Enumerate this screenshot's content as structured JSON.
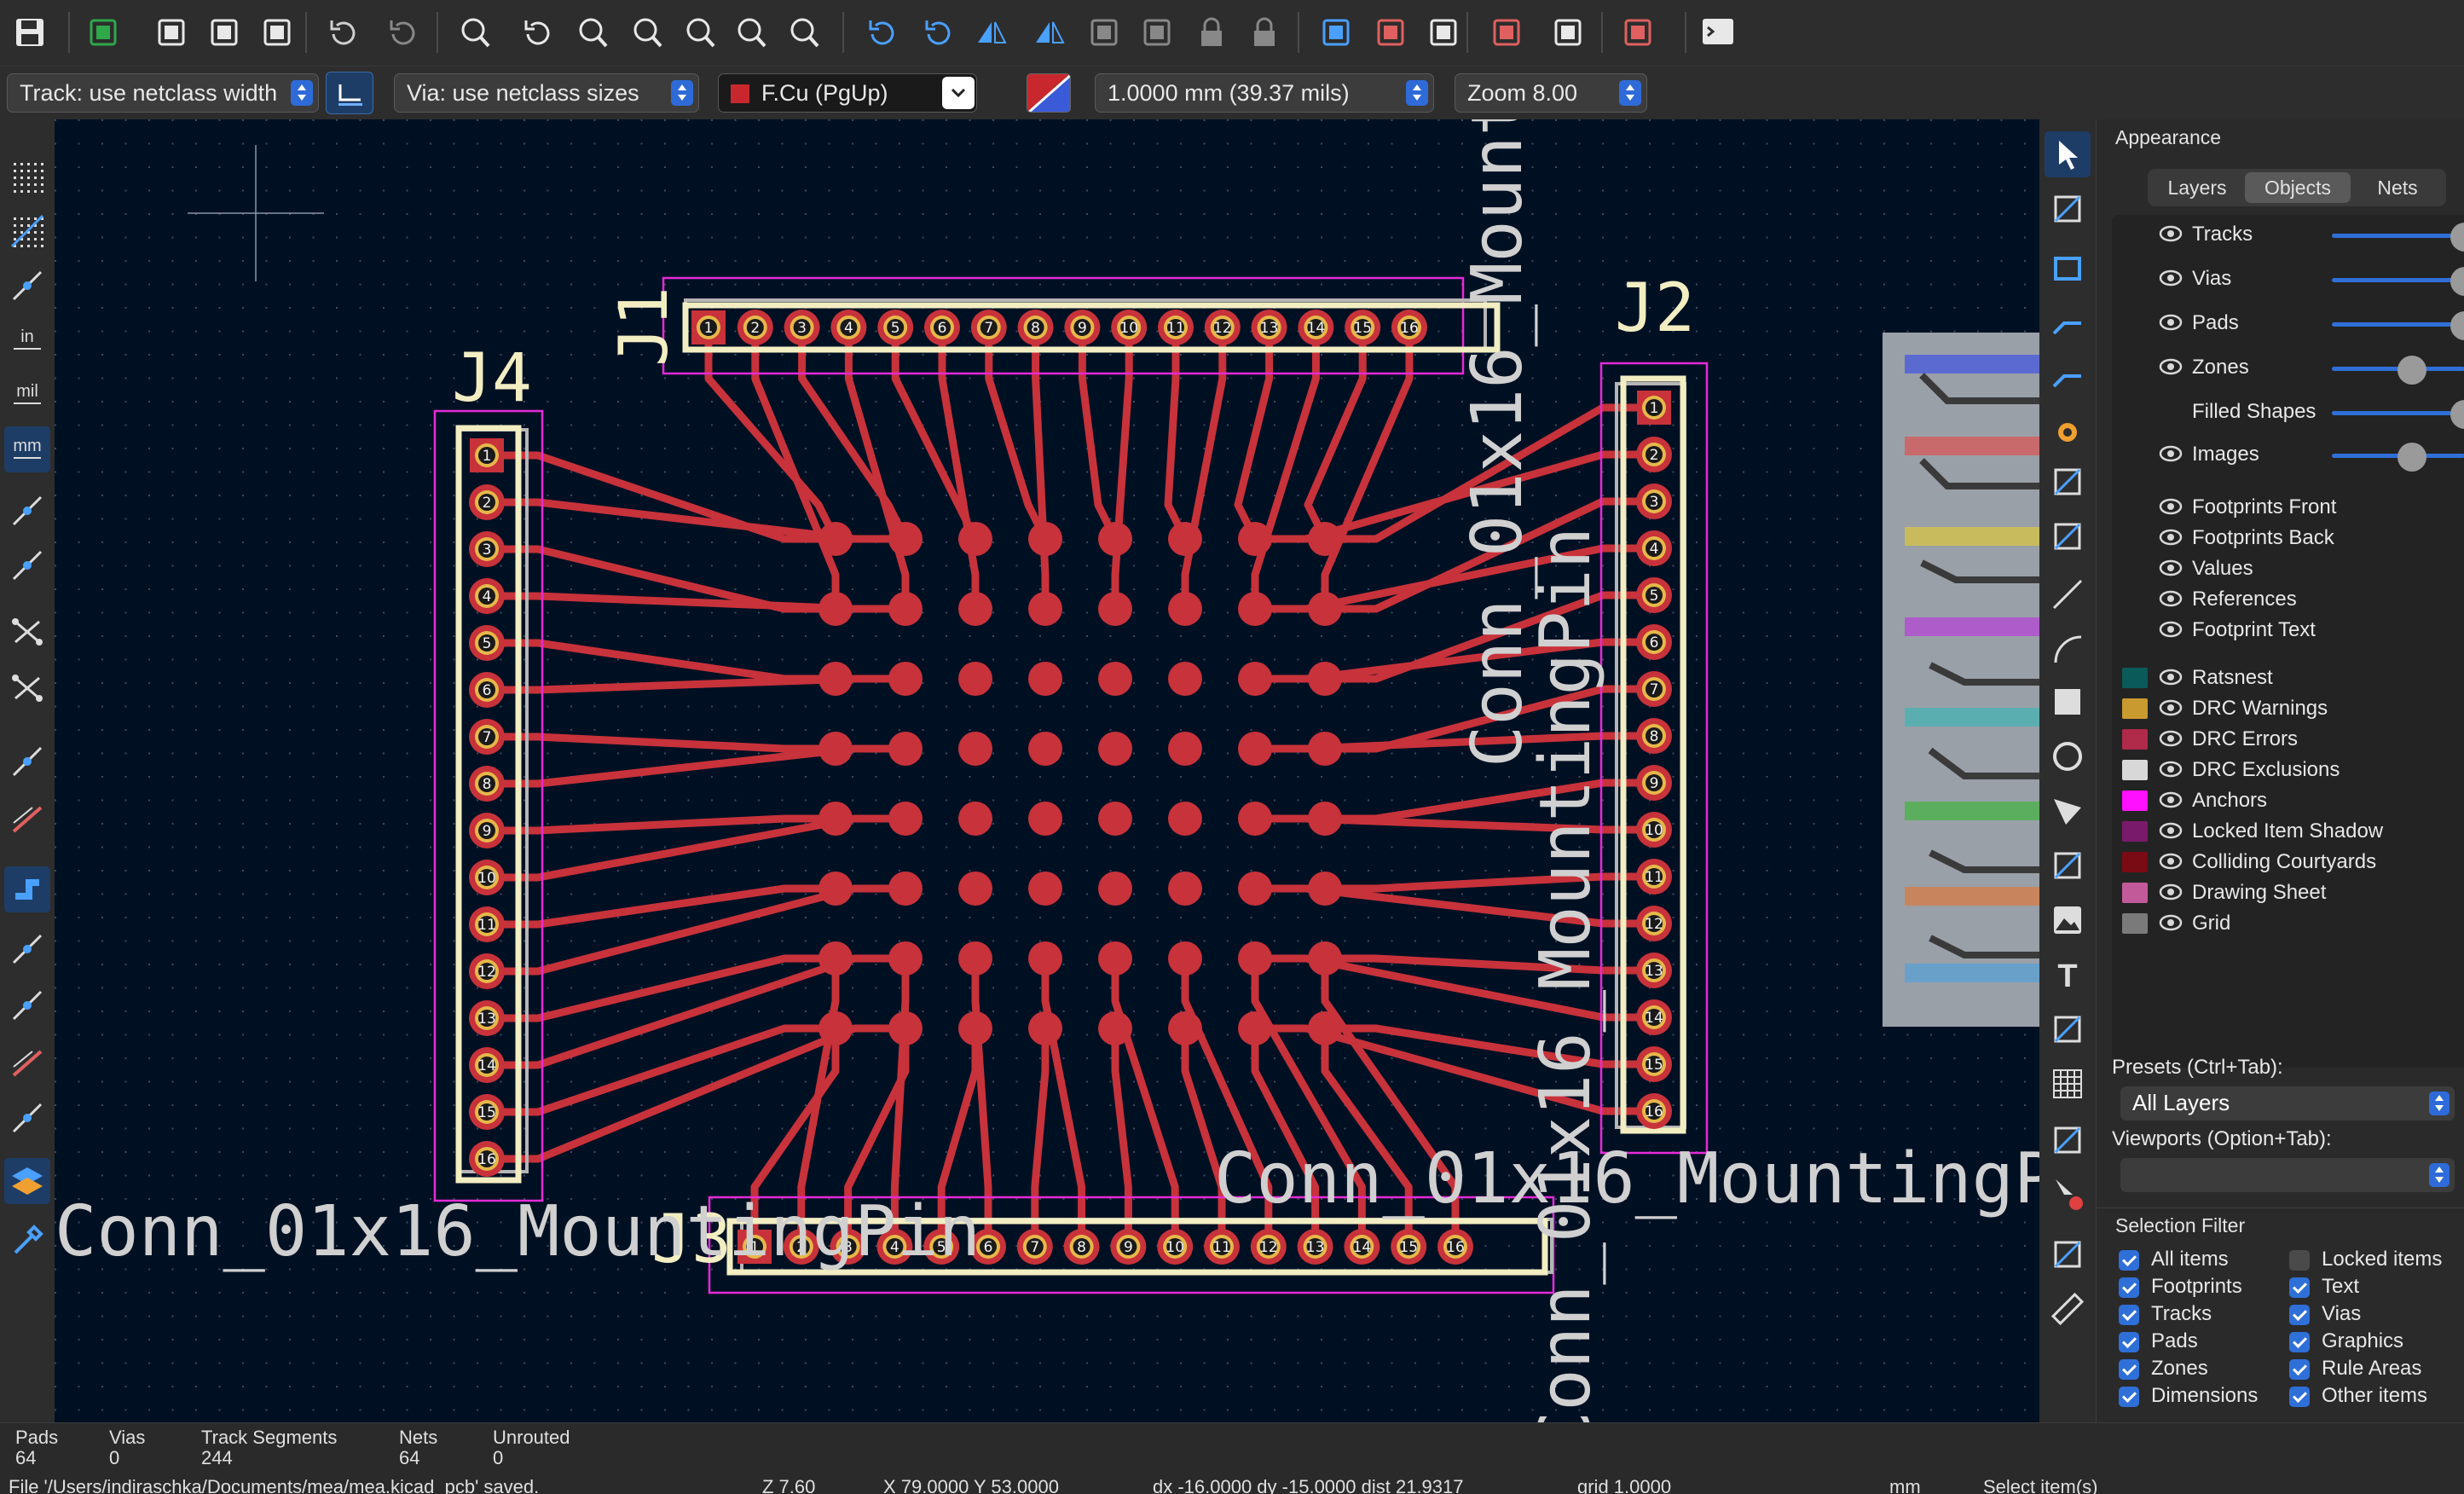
{
  "toolbar": {
    "icons": [
      "save-icon",
      "board-setup-icon",
      "page-settings-icon",
      "print-icon",
      "plot-icon",
      "undo-icon",
      "redo-icon",
      "find-icon",
      "refresh-icon",
      "zoom-in-icon",
      "zoom-out-icon",
      "zoom-fit-icon",
      "zoom-objects-icon",
      "zoom-selection-icon",
      "rotate-ccw-icon",
      "rotate-cw-icon",
      "flip-horizontal-icon",
      "flip-vertical-icon",
      "group-icon",
      "ungroup-icon",
      "lock-icon",
      "unlock-icon",
      "update-from-schematic-icon",
      "footprint-editor-icon",
      "footprint-library-icon",
      "scripting-icon",
      "drc-icon",
      "net-inspector-icon",
      "python-console-icon"
    ]
  },
  "options_bar": {
    "track_width": "Track: use netclass width",
    "via_size": "Via: use netclass sizes",
    "layer": "F.Cu (PgUp)",
    "grid": "1.0000 mm (39.37 mils)",
    "zoom": "Zoom 8.00",
    "layer_color": "#c8282d"
  },
  "board": {
    "refs": [
      "J1",
      "J2",
      "J3",
      "J4"
    ],
    "values": {
      "j1": "Conn_01x16_MountingPin",
      "j2": "Conn_01x16_MountingPin",
      "j3": "Conn_01x16_MountingPin",
      "j4": "Conn_01x16_MountingPin"
    },
    "pad_count_per_connector": 16,
    "colors": {
      "copper": "#c8323a",
      "silkscreen": "#f2eec2",
      "courtyard": "#e62ad8",
      "fab": "#b5b5b5",
      "background": "#001023",
      "value_text": "#d0d0d0"
    }
  },
  "appearance": {
    "title": "Appearance",
    "tabs": [
      "Layers",
      "Objects",
      "Nets"
    ],
    "selected_tab": "Objects",
    "objects": [
      {
        "label": "Tracks",
        "eye": true,
        "opacity": 1.0
      },
      {
        "label": "Vias",
        "eye": true,
        "opacity": 1.0
      },
      {
        "label": "Pads",
        "eye": true,
        "opacity": 1.0
      },
      {
        "label": "Zones",
        "eye": true,
        "opacity": 0.6
      },
      {
        "label": "Filled Shapes",
        "eye": false,
        "opacity": 1.0
      },
      {
        "label": "Images",
        "eye": true,
        "opacity": 0.6
      },
      {
        "label": "Footprints Front",
        "eye": true
      },
      {
        "label": "Footprints Back",
        "eye": true
      },
      {
        "label": "Values",
        "eye": true
      },
      {
        "label": "References",
        "eye": true
      },
      {
        "label": "Footprint Text",
        "eye": true
      },
      {
        "label": "Ratsnest",
        "eye": true,
        "color": "#0b5a5a"
      },
      {
        "label": "DRC Warnings",
        "eye": true,
        "color": "#c89a30"
      },
      {
        "label": "DRC Errors",
        "eye": true,
        "color": "#b02a4a"
      },
      {
        "label": "DRC Exclusions",
        "eye": true,
        "color": "#d8d8d8"
      },
      {
        "label": "Anchors",
        "eye": true,
        "color": "#ff10ff"
      },
      {
        "label": "Locked Item Shadow",
        "eye": true,
        "color": "#7a1a6a"
      },
      {
        "label": "Colliding Courtyards",
        "eye": true,
        "color": "#7a0a14"
      },
      {
        "label": "Drawing Sheet",
        "eye": true,
        "color": "#c25a9a"
      },
      {
        "label": "Grid",
        "eye": true,
        "color": "#7a7a7a"
      }
    ],
    "presets_label": "Presets (Ctrl+Tab):",
    "presets_value": "All Layers",
    "viewports_label": "Viewports (Option+Tab):",
    "viewports_value": ""
  },
  "selection_filter": {
    "title": "Selection Filter",
    "items": [
      {
        "label": "All items",
        "checked": true
      },
      {
        "label": "Locked items",
        "checked": false
      },
      {
        "label": "Footprints",
        "checked": true
      },
      {
        "label": "Text",
        "checked": true
      },
      {
        "label": "Tracks",
        "checked": true
      },
      {
        "label": "Vias",
        "checked": true
      },
      {
        "label": "Pads",
        "checked": true
      },
      {
        "label": "Graphics",
        "checked": true
      },
      {
        "label": "Zones",
        "checked": true
      },
      {
        "label": "Rule Areas",
        "checked": true
      },
      {
        "label": "Dimensions",
        "checked": true
      },
      {
        "label": "Other items",
        "checked": true
      }
    ]
  },
  "status": {
    "pads_label": "Pads",
    "pads": "64",
    "vias_label": "Vias",
    "vias": "0",
    "tracks_label": "Track Segments",
    "tracks": "244",
    "nets_label": "Nets",
    "nets": "64",
    "unrouted_label": "Unrouted",
    "unrouted": "0",
    "file": "File '/Users/indiraschka/Documents/mea/mea.kicad_pcb' saved.",
    "z": "Z 7.60",
    "xy": "X 79.0000  Y 53.0000",
    "delta": "dx -16.0000  dy -15.0000  dist 21.9317",
    "grid": "grid 1.0000",
    "units": "mm",
    "mode": "Select item(s)"
  }
}
